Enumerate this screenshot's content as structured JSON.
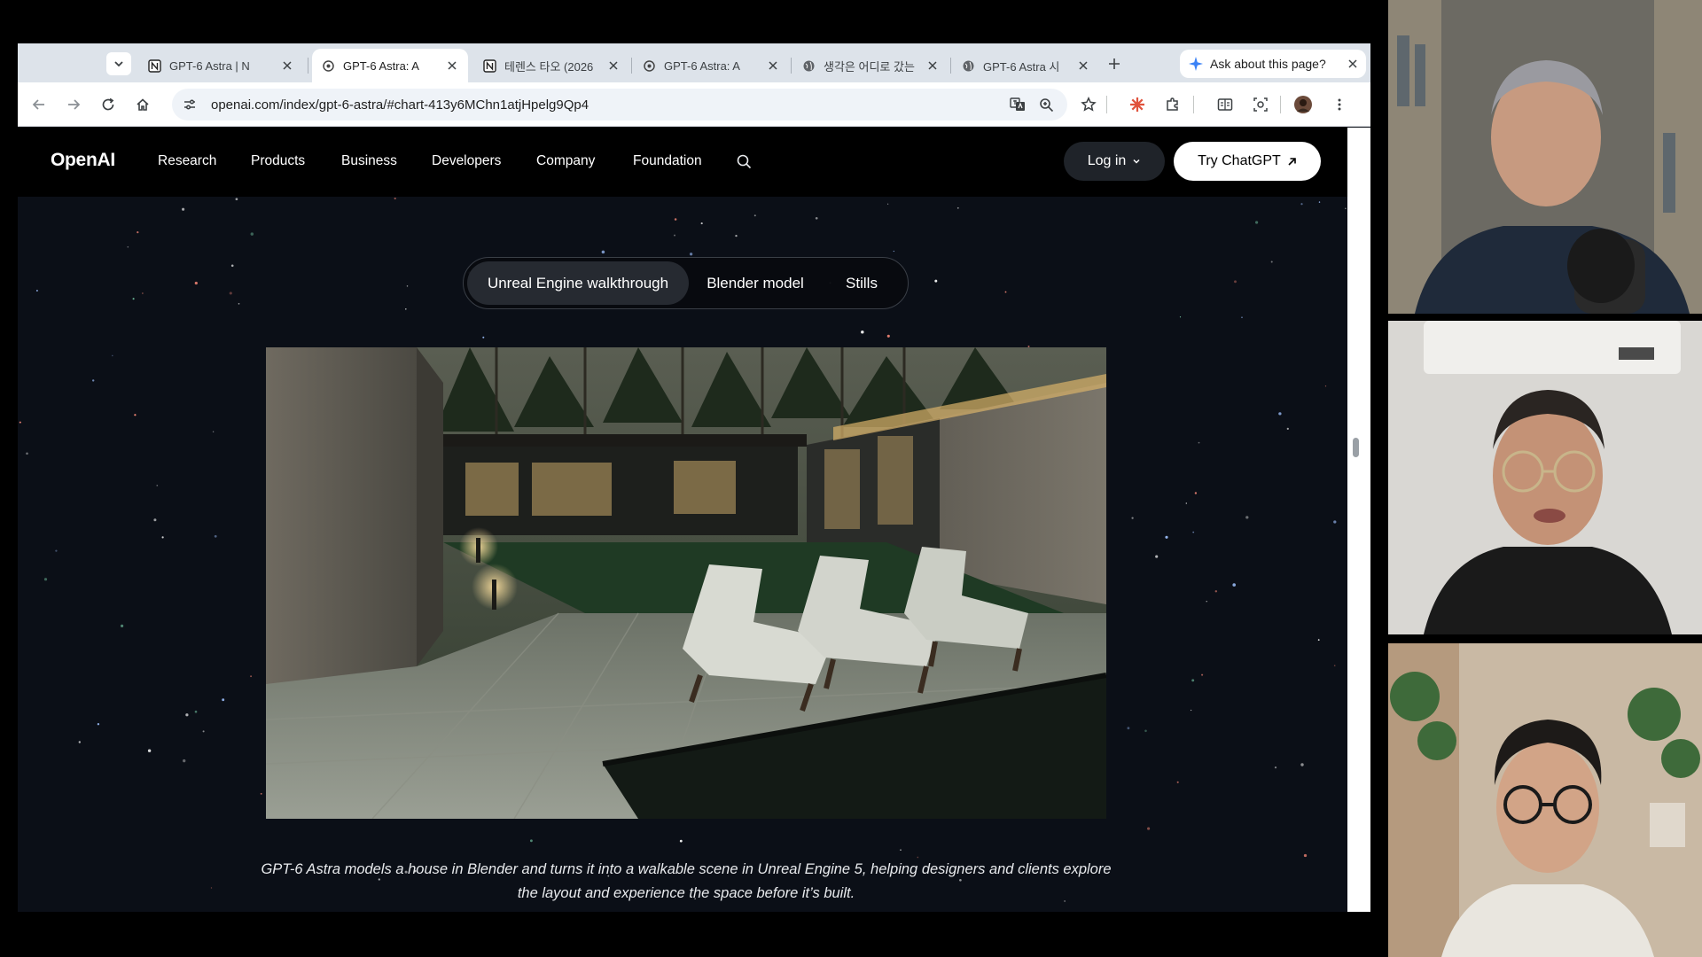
{
  "browser": {
    "tabs": [
      {
        "title": "GPT-6 Astra | N",
        "favicon": "notion-icon",
        "active": false
      },
      {
        "title": "GPT-6 Astra: A",
        "favicon": "openai-icon",
        "active": true
      },
      {
        "title": "테렌스 타오 (2026",
        "favicon": "notion-icon",
        "active": false
      },
      {
        "title": "GPT-6 Astra: A",
        "favicon": "openai-icon",
        "active": false
      },
      {
        "title": "생각은 어디로 갔는",
        "favicon": "globe-icon",
        "active": false
      },
      {
        "title": "GPT-6 Astra 시",
        "favicon": "globe-icon",
        "active": false
      }
    ],
    "ask_label": "Ask about this page?",
    "url": "openai.com/index/gpt-6-astra/#chart-413y6MChn1atjHpelg9Qp4"
  },
  "site": {
    "logo": "OpenAI",
    "nav": [
      "Research",
      "Products",
      "Business",
      "Developers",
      "Company",
      "Foundation"
    ],
    "login_label": "Log in",
    "try_label": "Try ChatGPT"
  },
  "segments": [
    {
      "label": "Unreal Engine walkthrough",
      "active": true
    },
    {
      "label": "Blender model",
      "active": false
    },
    {
      "label": "Stills",
      "active": false
    }
  ],
  "caption": "GPT-6 Astra models a house in Blender and turns it into a walkable scene in Unreal Engine 5, helping designers and clients explore the layout and experience the space before it’s built.",
  "colors": {
    "page_bg": "#0b0f17",
    "nav_bg": "#000000",
    "active_segment": "#262a31",
    "chrome_tabstrip": "#dde3ea"
  }
}
